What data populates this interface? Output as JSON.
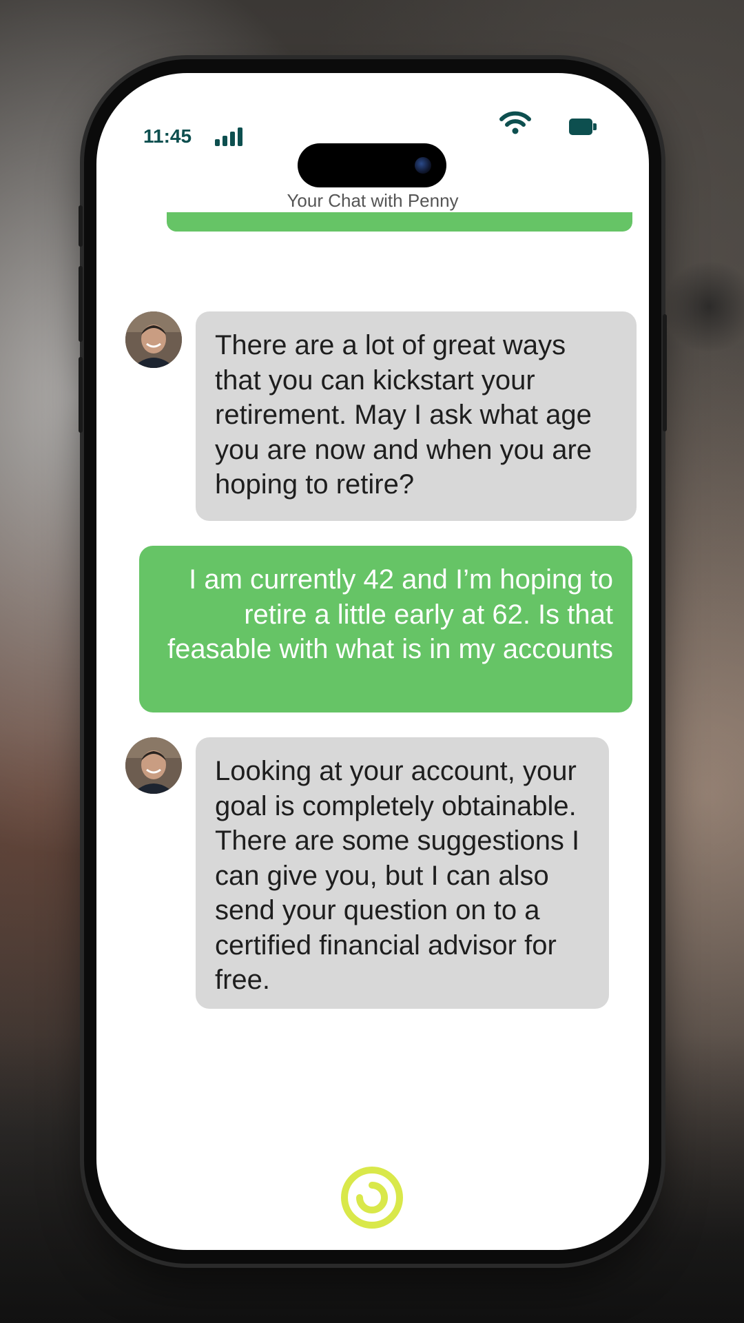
{
  "status_bar": {
    "time": "11:45",
    "signal_icon": "cellular-signal-icon",
    "wifi_icon": "wifi-icon",
    "battery_icon": "battery-icon",
    "accent_color": "#0d4f4f"
  },
  "header": {
    "title": "Your Chat with Penny",
    "bar_color": "#66c466"
  },
  "messages": [
    {
      "sender": "advisor",
      "avatar_icon": "advisor-avatar",
      "text": "There are a lot of great ways that you can kickstart your retirement. May I ask what age you are now and when you are hoping to retire?"
    },
    {
      "sender": "user",
      "text": "I am currently 42 and I’m hoping to retire a little early at 62. Is that feasable with what is in my accounts"
    },
    {
      "sender": "advisor",
      "avatar_icon": "advisor-avatar",
      "text": "Looking at your account, your goal is completely obtainable. There are some suggestions I can give you, but I can also send your question on to a certified financial advisor for free."
    }
  ],
  "colors": {
    "incoming_bubble": "#d8d8d8",
    "outgoing_bubble": "#66c466",
    "logo": "#d9e84a"
  },
  "footer": {
    "logo_icon": "brand-logo-icon"
  }
}
